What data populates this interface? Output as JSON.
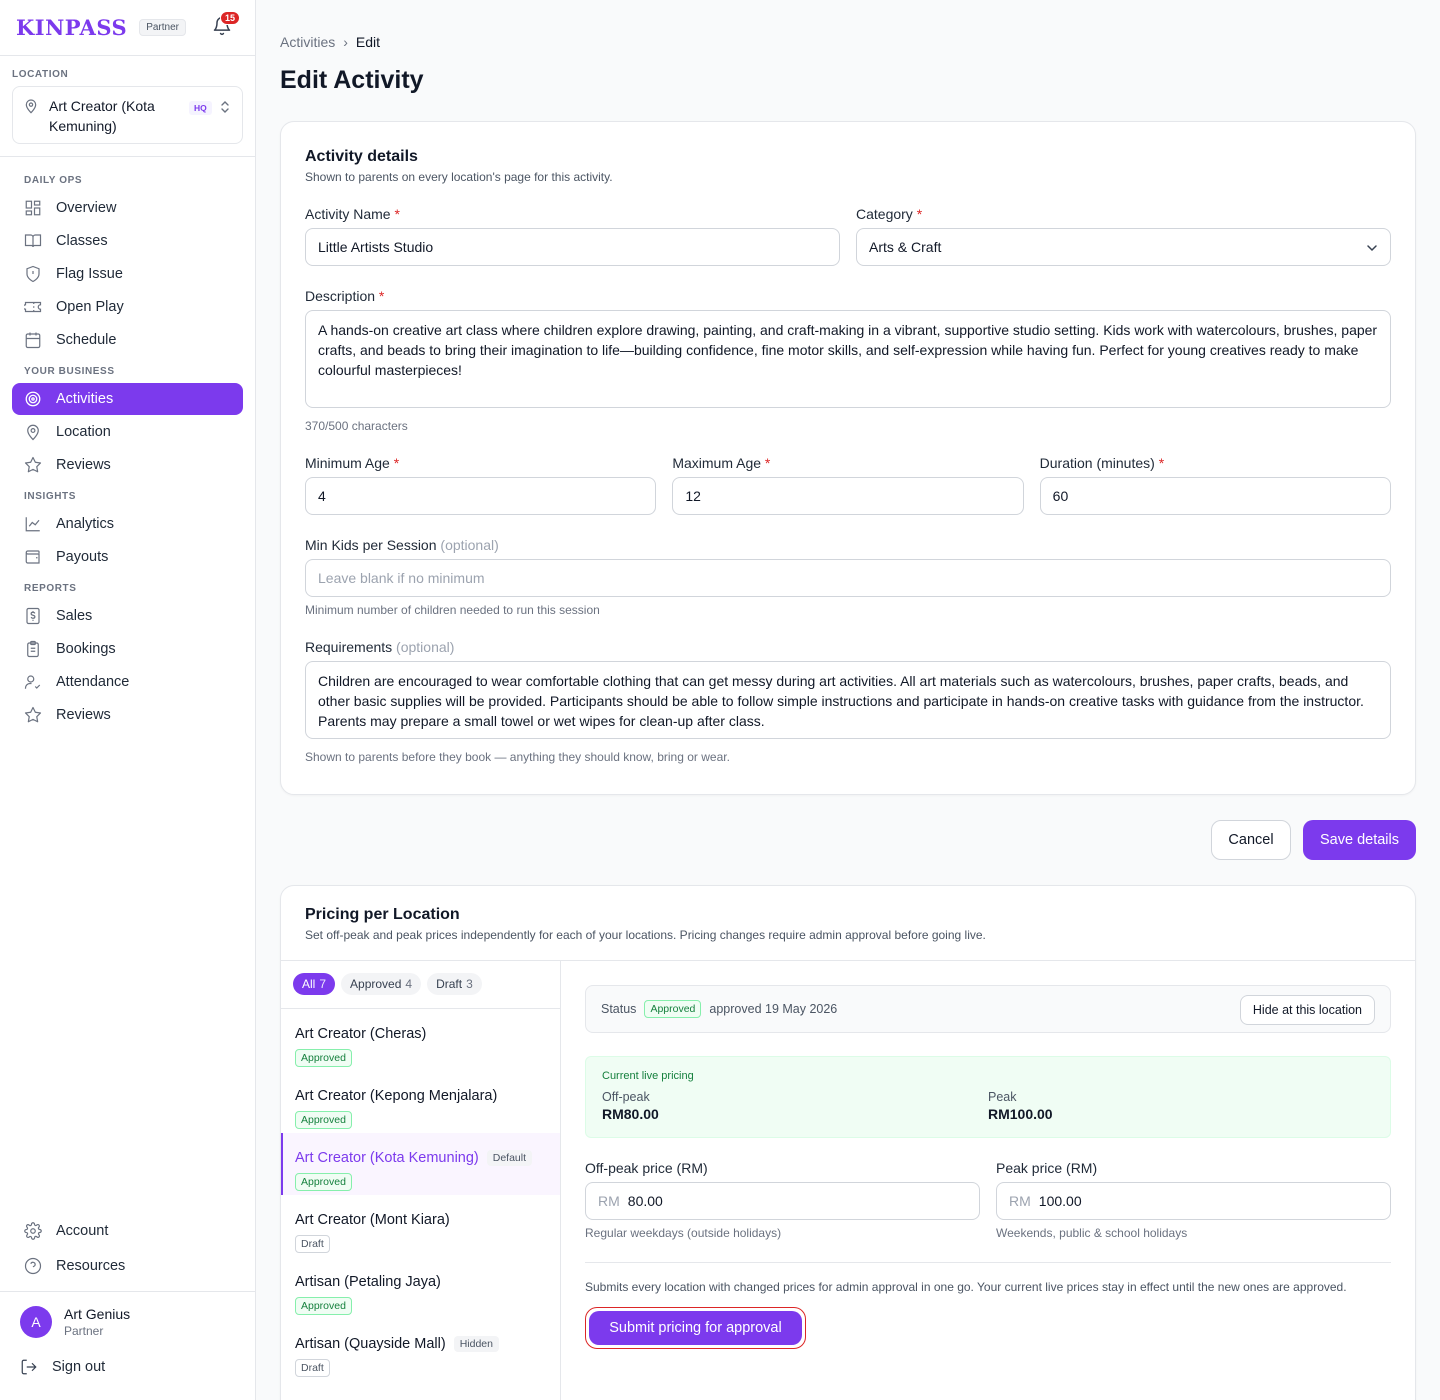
{
  "brand": {
    "logo": "KINPASS",
    "partner_label": "Partner",
    "notifications": "15"
  },
  "location": {
    "label": "LOCATION",
    "name": "Art Creator (Kota Kemuning)",
    "hq": "HQ"
  },
  "nav": {
    "daily_ops": "DAILY OPS",
    "overview": "Overview",
    "classes": "Classes",
    "flag_issue": "Flag Issue",
    "open_play": "Open Play",
    "schedule": "Schedule",
    "your_business": "YOUR BUSINESS",
    "activities": "Activities",
    "location": "Location",
    "reviews": "Reviews",
    "insights": "INSIGHTS",
    "analytics": "Analytics",
    "payouts": "Payouts",
    "reports": "REPORTS",
    "sales": "Sales",
    "bookings": "Bookings",
    "attendance": "Attendance",
    "reviews2": "Reviews",
    "account": "Account",
    "resources": "Resources"
  },
  "user": {
    "initial": "A",
    "name": "Art Genius",
    "role": "Partner",
    "signout": "Sign out"
  },
  "breadcrumb": {
    "parent": "Activities",
    "sep": "›",
    "current": "Edit"
  },
  "page_title": "Edit Activity",
  "details": {
    "title": "Activity details",
    "subtitle": "Shown to parents on every location's page for this activity.",
    "name_label": "Activity Name",
    "name_value": "Little Artists Studio",
    "category_label": "Category",
    "category_value": "Arts & Craft",
    "desc_label": "Description",
    "desc_value": "A hands-on creative art class where children explore drawing, painting, and craft-making in a vibrant, supportive studio setting. Kids work with watercolours, brushes, paper crafts, and beads to bring their imagination to life—building confidence, fine motor skills, and self-expression while having fun. Perfect for young creatives ready to make colourful masterpieces!",
    "desc_count": "370/500 characters",
    "min_age_label": "Minimum Age",
    "min_age_value": "4",
    "max_age_label": "Maximum Age",
    "max_age_value": "12",
    "duration_label": "Duration (minutes)",
    "duration_value": "60",
    "min_kids_label": "Min Kids per Session",
    "optional": "(optional)",
    "min_kids_placeholder": "Leave blank if no minimum",
    "min_kids_hint": "Minimum number of children needed to run this session",
    "req_label": "Requirements",
    "req_value": "Children are encouraged to wear comfortable clothing that can get messy during art activities. All art materials such as watercolours, brushes, paper crafts, beads, and other basic supplies will be provided. Participants should be able to follow simple instructions and participate in hands-on creative tasks with guidance from the instructor. Parents may prepare a small towel or wet wipes for clean-up after class.",
    "req_hint": "Shown to parents before they book — anything they should know, bring or wear.",
    "required_mark": "*"
  },
  "actions": {
    "cancel": "Cancel",
    "save": "Save details"
  },
  "pricing": {
    "title": "Pricing per Location",
    "subtitle": "Set off-peak and peak prices independently for each of your locations. Pricing changes require admin approval before going live.",
    "filters": [
      {
        "label": "All",
        "count": "7"
      },
      {
        "label": "Approved",
        "count": "4"
      },
      {
        "label": "Draft",
        "count": "3"
      }
    ],
    "locations": [
      {
        "name": "Art Creator (Cheras)",
        "status": "Approved"
      },
      {
        "name": "Art Creator (Kepong Menjalara)",
        "status": "Approved"
      },
      {
        "name": "Art Creator (Kota Kemuning)",
        "tag": "Default",
        "status": "Approved"
      },
      {
        "name": "Art Creator (Mont Kiara)",
        "status": "Draft"
      },
      {
        "name": "Artisan (Petaling Jaya)",
        "status": "Approved"
      },
      {
        "name": "Artisan (Quayside Mall)",
        "tag": "Hidden",
        "status": "Draft"
      }
    ],
    "status_label": "Status",
    "status_value": "Approved",
    "status_date": "approved 19 May 2026",
    "hide_button": "Hide at this location",
    "live_title": "Current live pricing",
    "offpeak_k": "Off-peak",
    "offpeak_v": "RM80.00",
    "peak_k": "Peak",
    "peak_v": "RM100.00",
    "offpeak_label": "Off-peak price (RM)",
    "offpeak_input": "80.00",
    "offpeak_hint": "Regular weekdays (outside holidays)",
    "peak_label": "Peak price (RM)",
    "peak_input": "100.00",
    "peak_hint": "Weekends, public & school holidays",
    "currency": "RM",
    "submit_note": "Submits every location with changed prices for admin approval in one go. Your current live prices stay in effect until the new ones are approved.",
    "submit_button": "Submit pricing for approval"
  },
  "colors": {
    "accent": "#7c3aed",
    "approved": "#15803d",
    "required": "#dc2626"
  }
}
